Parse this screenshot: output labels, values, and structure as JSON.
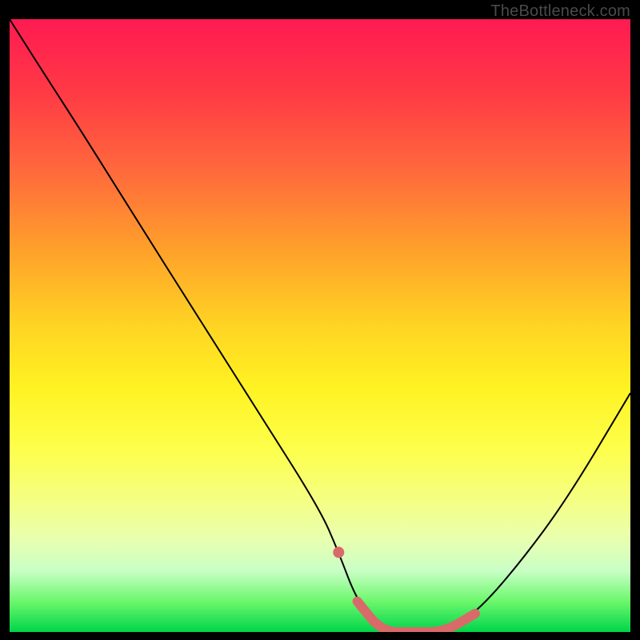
{
  "watermark": "TheBottleneck.com",
  "chart_data": {
    "type": "line",
    "title": "",
    "xlabel": "",
    "ylabel": "",
    "xlim": [
      0,
      100
    ],
    "ylim": [
      0,
      100
    ],
    "series": [
      {
        "name": "curve",
        "x": [
          0,
          5,
          12,
          20,
          30,
          40,
          50,
          53,
          56,
          60,
          65,
          70,
          75,
          82,
          90,
          100
        ],
        "values": [
          100,
          92,
          81,
          68,
          52,
          36,
          20,
          13,
          5,
          0,
          0,
          0,
          3,
          11,
          22,
          39
        ]
      }
    ],
    "markers": [
      {
        "name": "dot",
        "x": 53,
        "y": 13
      },
      {
        "name": "segment",
        "x": [
          56,
          60,
          65,
          70,
          75
        ],
        "y": [
          5,
          0,
          0,
          0,
          3
        ]
      }
    ],
    "colors": {
      "curve": "#000000",
      "marker": "#d96a6a"
    }
  }
}
